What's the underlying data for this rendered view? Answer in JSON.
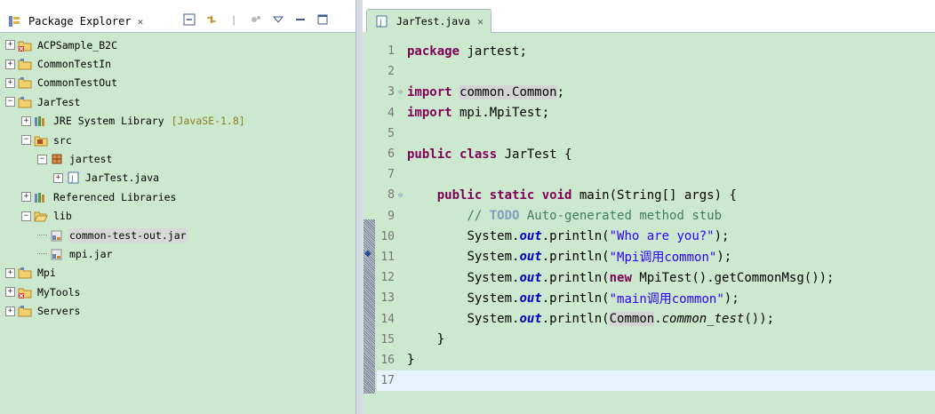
{
  "package_explorer": {
    "tab_label": "Package Explorer",
    "tab_close": "✕",
    "tree": [
      {
        "id": "acpsample",
        "label": "ACPSample_B2C",
        "icon": "project-error-icon",
        "indent": 0,
        "expander": "+"
      },
      {
        "id": "commontestin",
        "label": "CommonTestIn",
        "icon": "project-folder-icon",
        "indent": 0,
        "expander": "+"
      },
      {
        "id": "commontestout",
        "label": "CommonTestOut",
        "icon": "project-folder-icon",
        "indent": 0,
        "expander": "+"
      },
      {
        "id": "jartest",
        "label": "JarTest",
        "icon": "project-folder-icon",
        "indent": 0,
        "expander": "-"
      },
      {
        "id": "jre",
        "label": "JRE System Library",
        "decoration": "[JavaSE-1.8]",
        "icon": "library-icon",
        "indent": 1,
        "expander": "+"
      },
      {
        "id": "src",
        "label": "src",
        "icon": "source-folder-icon",
        "indent": 1,
        "expander": "-"
      },
      {
        "id": "pkg-jartest",
        "label": "jartest",
        "icon": "package-icon",
        "indent": 2,
        "expander": "-"
      },
      {
        "id": "jartest-java",
        "label": "JarTest.java",
        "icon": "java-file-icon",
        "indent": 3,
        "expander": "+"
      },
      {
        "id": "reflibs",
        "label": "Referenced Libraries",
        "icon": "library-icon",
        "indent": 1,
        "expander": "+"
      },
      {
        "id": "lib",
        "label": "lib",
        "icon": "open-folder-icon",
        "indent": 1,
        "expander": "-"
      },
      {
        "id": "common-test-out-jar",
        "label": "common-test-out.jar",
        "icon": "jar-icon",
        "indent": 2,
        "expander": "",
        "selected": true
      },
      {
        "id": "mpi-jar",
        "label": "mpi.jar",
        "icon": "jar-icon",
        "indent": 2,
        "expander": ""
      },
      {
        "id": "mpi",
        "label": "Mpi",
        "icon": "project-folder-icon",
        "indent": 0,
        "expander": "+"
      },
      {
        "id": "mytools",
        "label": "MyTools",
        "icon": "project-error-icon",
        "indent": 0,
        "expander": "+"
      },
      {
        "id": "servers",
        "label": "Servers",
        "icon": "project-folder-icon",
        "indent": 0,
        "expander": "+"
      }
    ]
  },
  "editor": {
    "tab_label": "JarTest.java",
    "tab_close": "✕",
    "line_numbers": [
      "1",
      "2",
      "3",
      "4",
      "5",
      "6",
      "7",
      "8",
      "9",
      "10",
      "11",
      "12",
      "13",
      "14",
      "15",
      "16",
      "17"
    ],
    "code": {
      "l1": {
        "kw": "package",
        "rest": " jartest;"
      },
      "l3": {
        "kw": "import",
        "hl": "common.Common",
        "rest": ";"
      },
      "l4": {
        "kw": "import",
        "rest": " mpi.MpiTest;"
      },
      "l6": {
        "kw": "public class",
        "rest": " JarTest {"
      },
      "l8": {
        "kw": "public static void",
        "rest": " main(String[] args) {"
      },
      "l9": {
        "cmt": "// ",
        "todo": "TODO",
        "rest": " Auto-generated method stub"
      },
      "system": "System.",
      "out": "out",
      "println": ".println(",
      "close": ");",
      "s10": "\"Who are you?\"",
      "s11": "\"Mpi调用common\"",
      "l12_new": "new",
      "l12_rest": " MpiTest().getCommonMsg());",
      "s13": "\"main调用common\"",
      "l14_common": "Common",
      "l14_method": "common_test",
      "l14_tail": "());",
      "l15": "}",
      "l16": "}"
    }
  }
}
